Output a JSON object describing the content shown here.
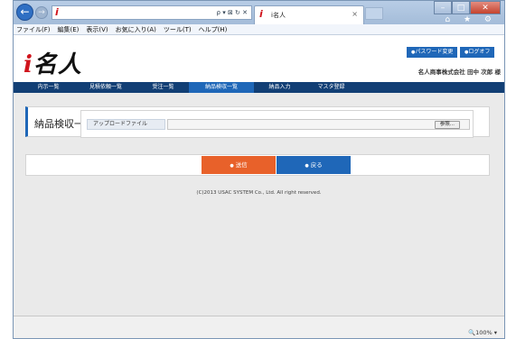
{
  "browser": {
    "address_logo": "i",
    "address_icons": "ρ ▾ ⊠ ↻ ✕",
    "tab_logo": "i",
    "tab_title": "i名人",
    "tab_close": "×",
    "toolbar_icons": "⌂ ★ ⚙",
    "window_controls": [
      "–",
      "□",
      "✕"
    ],
    "menu": [
      "ファイル(F)",
      "編集(E)",
      "表示(V)",
      "お気に入り(A)",
      "ツール(T)",
      "ヘルプ(H)"
    ],
    "zoom": "🔍100%  ▾"
  },
  "header": {
    "logo_i": "i",
    "logo_rest": "名人",
    "password_button": "パスワード変更",
    "logout_button": "ログオフ",
    "company_user": "名人商事株式会社 田中 次郎 様"
  },
  "nav": [
    "内示一覧",
    "見積依頼一覧",
    "受注一覧",
    "納品検収一覧",
    "納品入力",
    "マスタ登録"
  ],
  "page": {
    "title": "納品検収一覧",
    "upload_label": "アップロードファイル",
    "browse_button": "参照...",
    "send_button": "送信",
    "back_button": "戻る",
    "copyright": "(C)2013 USAC SYSTEM Co., Ltd. All right reserved."
  },
  "colors": {
    "nav_bg": "#123f75",
    "accent_blue": "#1f67b8",
    "accent_orange": "#e8612a",
    "logo_red": "#d0141c"
  }
}
